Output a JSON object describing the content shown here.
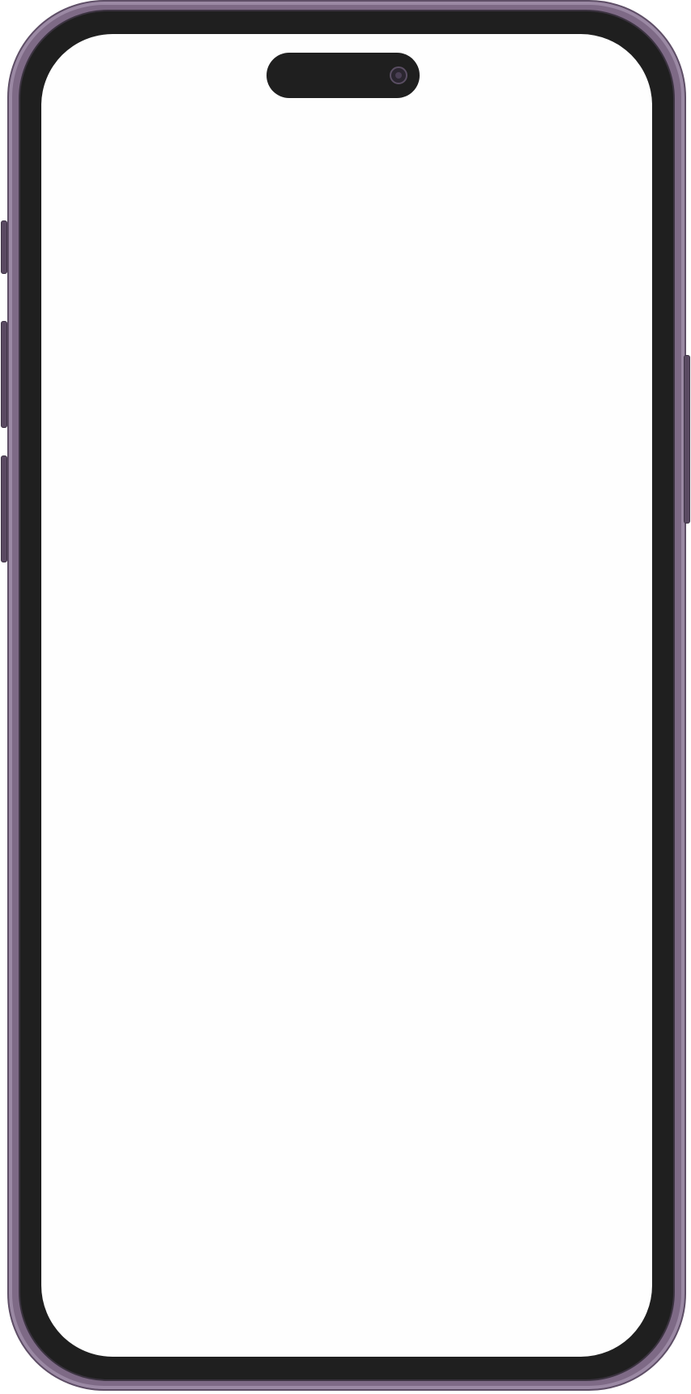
{
  "device": {
    "frame_color": "#7e6a86",
    "bezel_color": "#1f1f1f",
    "screen_color": "#fefefe",
    "icons": [
      "front-camera-icon"
    ]
  }
}
